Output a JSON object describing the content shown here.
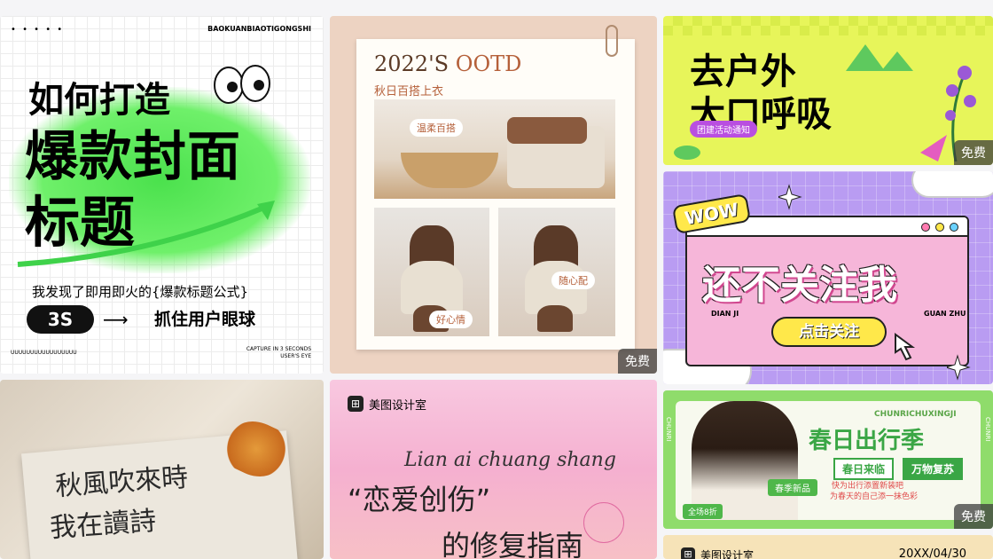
{
  "cards": {
    "c1": {
      "dots": "• • • • •",
      "brand": "BAOKUANBIAOTIGONGSHI",
      "how": "如何打造",
      "hot": "爆款封面",
      "title": "标题",
      "sub": "我发现了即用即火的{爆款标题公式}",
      "pill": "3S",
      "arrow": "⟶",
      "grab": "抓住用户眼球",
      "foot_left": "UUUUUUUUUUUUUUUUU",
      "foot_right_1": "CAPTURE IN 3 SECONDS",
      "foot_right_2": "USER'S EYE"
    },
    "c2": {
      "ootd_year": "2022'S",
      "ootd_word": "OOTD",
      "sub": "秋日百搭上衣",
      "tag1": "温柔百搭",
      "tag2": "好心情",
      "tag3": "随心配",
      "badge": "免费"
    },
    "c3": {
      "line1": "去户外",
      "line2": "大口呼吸",
      "pill": "团建活动通知",
      "badge": "免费"
    },
    "c4": {
      "wow": "WOW",
      "big": "还不关注我",
      "left_caption": "DIAN JI",
      "right_caption": "GUAN ZHU",
      "button": "点击关注"
    },
    "c5": {
      "line1": "秋風吹來時",
      "line2": "我在讀詩"
    },
    "c6": {
      "logo": "⊞",
      "brand": "美图设计室",
      "script": "Lian ai chuang shang",
      "quote": "“恋爱创伤”",
      "guide": "的修复指南"
    },
    "c7": {
      "side_left": "CHUNRI",
      "side_right": "CHUNRI",
      "pinyin": "CHUNRICHUXINGJI",
      "title": "春日出行季",
      "tag1": "春日来临",
      "tag2": "万物复苏",
      "new": "春季新品",
      "desc1": "快为出行添置新装吧",
      "desc2": "为春天的自己添一抹色彩",
      "discount": "全场8折",
      "badge": "免费"
    },
    "c8": {
      "logo": "⊞",
      "brand": "美图设计室",
      "date": "20XX/04/30"
    }
  }
}
